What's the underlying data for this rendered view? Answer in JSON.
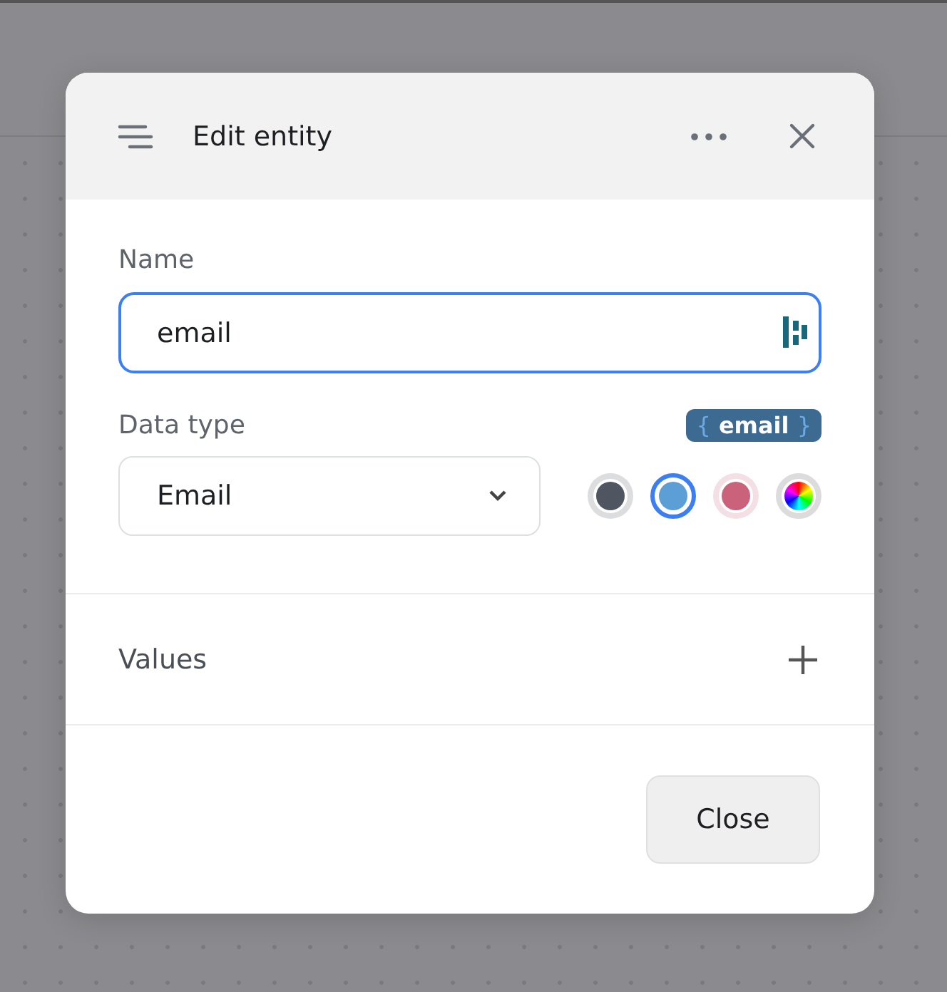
{
  "dialog": {
    "title": "Edit entity",
    "name_field": {
      "label": "Name",
      "value": "email",
      "focused": true
    },
    "data_type": {
      "label": "Data type",
      "value": "Email"
    },
    "badge": {
      "open": "{",
      "text": "email",
      "close": "}"
    },
    "colors": [
      {
        "kind": "solid",
        "color": "#4f5661",
        "selected": false
      },
      {
        "kind": "solid",
        "color": "#5b9fd6",
        "selected": true
      },
      {
        "kind": "solid",
        "color": "#c9627a",
        "selected": false
      },
      {
        "kind": "spectrum",
        "selected": false
      }
    ],
    "values_label": "Values",
    "buttons": [
      "Close"
    ]
  }
}
